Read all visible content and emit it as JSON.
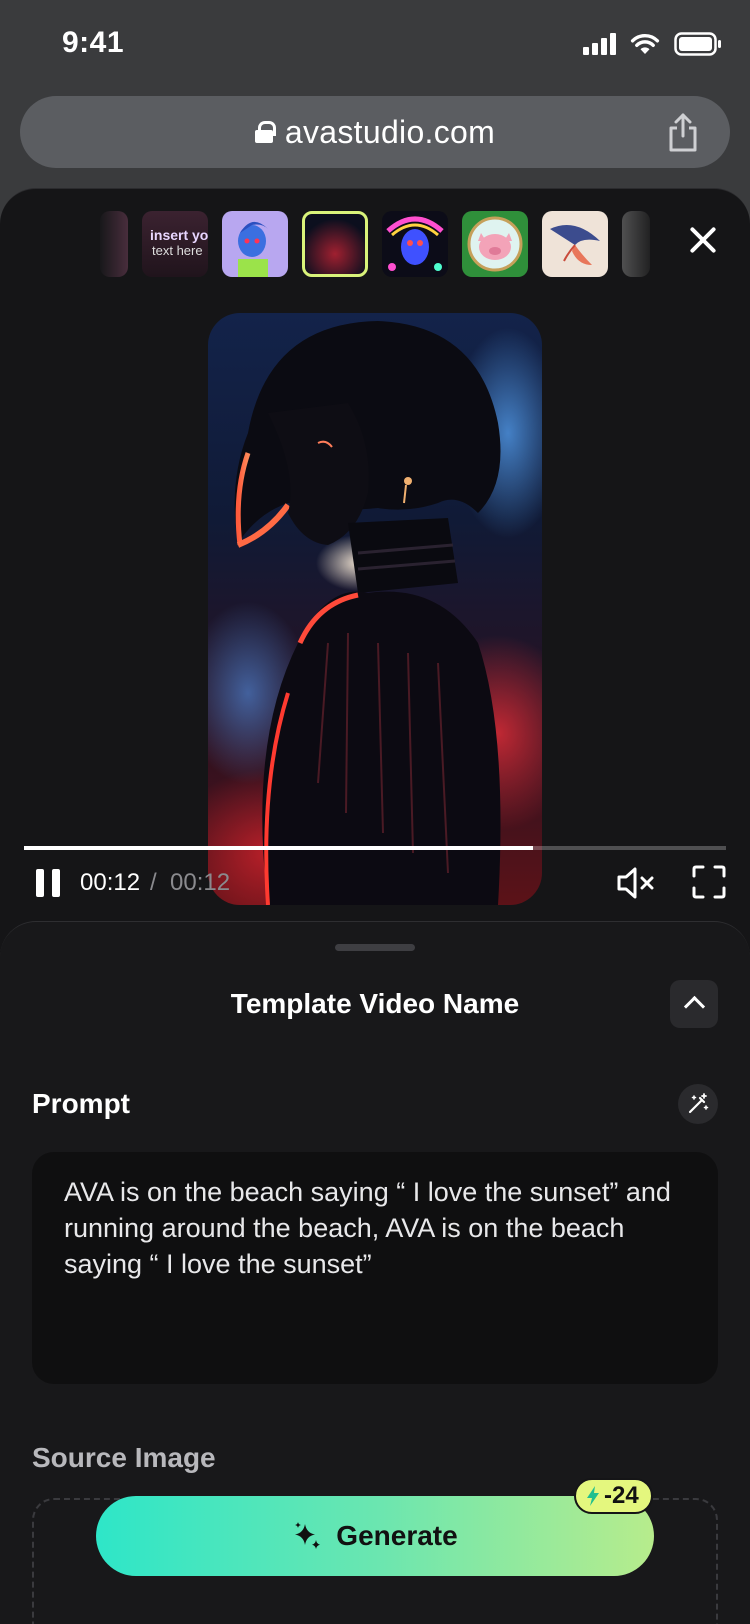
{
  "status_bar": {
    "time": "9:41"
  },
  "browser": {
    "url": "avastudio.com"
  },
  "thumbnails": [
    {
      "name": "partial-left"
    },
    {
      "name": "insert-text",
      "text_line1": "insert you",
      "text_line2": "text here"
    },
    {
      "name": "blue-girl"
    },
    {
      "name": "dark-portrait"
    },
    {
      "name": "psychedelic-figure"
    },
    {
      "name": "pig-medallion"
    },
    {
      "name": "butterfly-wing"
    },
    {
      "name": "partial-right"
    }
  ],
  "player": {
    "current_time": "00:12",
    "separator": "/",
    "total_time": "00:12",
    "progress_percent": 72.5
  },
  "panel": {
    "title": "Template Video Name",
    "prompt_label": "Prompt",
    "prompt_text": "AVA is on the beach saying “ I love the sunset” and running around the beach, AVA is on the beach saying “ I love the sunset”",
    "source_label": "Source Image"
  },
  "generate": {
    "label": "Generate",
    "cost": "-24"
  },
  "colors": {
    "accent": "#d9f27a",
    "gradient_start": "#2ee6c8",
    "gradient_end": "#b7ec8c",
    "badge": "#e4f77e"
  }
}
